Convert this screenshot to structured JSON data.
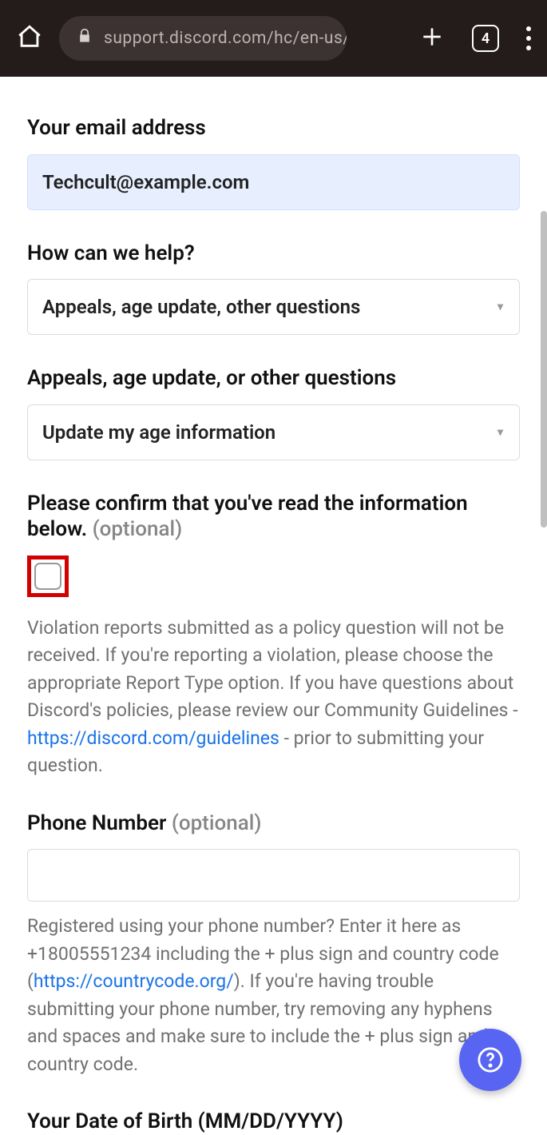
{
  "browser": {
    "url": "support.discord.com/hc/en-us/requ",
    "tab_count": "4"
  },
  "form": {
    "email": {
      "label": "Your email address",
      "value": "Techcult@example.com"
    },
    "help": {
      "label": "How can we help?",
      "value": "Appeals, age update, other questions"
    },
    "category": {
      "label": "Appeals, age update, or other questions",
      "value": "Update my age information"
    },
    "confirm": {
      "label_pre": "Please confirm that you've read the information below. ",
      "label_opt": "(optional)",
      "help_pre": "Violation reports submitted as a policy question will not be received. If you're reporting a violation, please choose the appropriate Report Type option. If you have questions about Discord's policies, please review our Community Guidelines - ",
      "link": "https://discord.com/guidelines",
      "help_post": " - prior to submitting your question."
    },
    "phone": {
      "label": "Phone Number ",
      "label_opt": "(optional)",
      "help_pre": "Registered using your phone number? Enter it here as +18005551234 including the + plus sign and country code (",
      "link": "https://countrycode.org/",
      "help_post": "). If you're having trouble submitting your phone number, try removing any hyphens and spaces and make sure to include the + plus sign and country code."
    },
    "dob": {
      "label": "Your Date of Birth (MM/DD/YYYY)"
    }
  }
}
